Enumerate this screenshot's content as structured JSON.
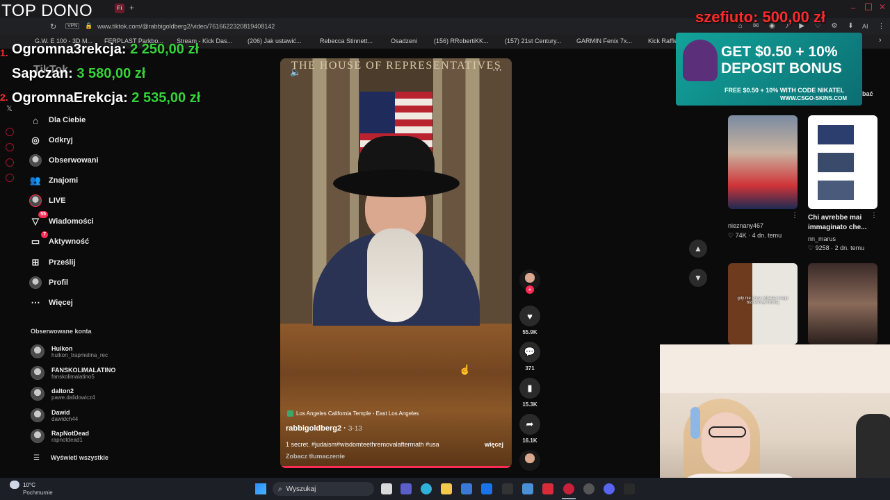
{
  "browser": {
    "tab_label": "Fi",
    "url": "www.tiktok.com/@rabbigoldberg2/video/7616622320819408142",
    "address_prefix": "VPN",
    "bookmarks": [
      "G.W. E 100 - 3D M...",
      "FERPLAST Parkbo...",
      "Stream - Kick Das...",
      "(206) Jak ustawić...",
      "Rebecca Stinnett...",
      "Osadzeni",
      "(156) RRobertiKK...",
      "(157) 21st Century...",
      "GARMIN Fenix 7x...",
      "Kick Raffle"
    ],
    "ai_label": "AI"
  },
  "overlay": {
    "top_title": "TOP DONO",
    "donors": [
      {
        "name": "Ogromna3rekcja: ",
        "amount": "2 250,00 zł"
      },
      {
        "name": "Sapczan: ",
        "amount": "3 580,00 zł"
      },
      {
        "name": "OgromnaErekcja: ",
        "amount": "2 535,00 zł"
      }
    ],
    "top_donator": "szefiuto: 500,00 zł",
    "list_numbers": [
      "1.",
      "2."
    ],
    "tiktok_logo": "TikTok"
  },
  "sidebar": {
    "nav": [
      {
        "label": "Dla Ciebie",
        "icon": "home-icon"
      },
      {
        "label": "Odkryj",
        "icon": "compass-icon"
      },
      {
        "label": "Obserwowani",
        "icon": "following-avatar-icon"
      },
      {
        "label": "Znajomi",
        "icon": "friends-icon"
      },
      {
        "label": "LIVE",
        "icon": "live-icon"
      },
      {
        "label": "Wiadomości",
        "icon": "messages-icon",
        "badge": "55"
      },
      {
        "label": "Aktywność",
        "icon": "activity-icon",
        "badge": "7"
      },
      {
        "label": "Prześlij",
        "icon": "upload-icon"
      },
      {
        "label": "Profil",
        "icon": "profile-avatar-icon"
      },
      {
        "label": "Więcej",
        "icon": "more-icon"
      }
    ],
    "followed_title": "Obserwowane konta",
    "accounts": [
      {
        "name": "Hulkon",
        "handle": "hulkon_trapmelina_rec"
      },
      {
        "name": "FANSKOLIMALATINO",
        "handle": "fanskolimalatino5"
      },
      {
        "name": "dalton2",
        "handle": "pawe.dalidowicz4"
      },
      {
        "name": "Dawid",
        "handle": "dawidch44"
      },
      {
        "name": "RapNotDead",
        "handle": "rapnotdead1"
      }
    ],
    "show_all": "Wyświetl wszystkie"
  },
  "video": {
    "heading": "THE HOUSE OF REPRESENTATIVES",
    "location": "Los Angeles California Temple - East Los Angeles",
    "author": "rabbigoldberg2",
    "date": "3-13",
    "description": "1 secret. #judaism#wisdomteethremovalaftermath #usa",
    "more": "więcej",
    "translate": "Zobacz tłumaczenie"
  },
  "actions": {
    "likes": "55.9K",
    "comments": "371",
    "saves": "15.3K",
    "shares": "16.1K"
  },
  "ad": {
    "line1": "GET $0.50 + 10%",
    "line2": "DEPOSIT BONUS",
    "line3": "FREE $0.50 + 10% WITH CODE NIKATEL",
    "line4": "WWW.CSGO-SKINS.COM",
    "cut_text": "bać"
  },
  "related": [
    {
      "author": "nieznany467",
      "likes": "74K",
      "age": "4 dn. temu"
    },
    {
      "title": "Chi avrebbe mai immaginato che...",
      "author": "nn_marus",
      "likes": "9258",
      "age": "2 dn. temu"
    }
  ],
  "thumb_caption": "gdy nie chcę odpalać mego biznesowy dzisiaj",
  "taskbar": {
    "weather_temp": "10°C",
    "weather_desc": "Pochmurnie",
    "search_label": "Wyszukaj"
  },
  "colors": {
    "accent": "#fe2c55",
    "donation_amount": "#35d33a",
    "top_donator": "#ff2a2a"
  }
}
